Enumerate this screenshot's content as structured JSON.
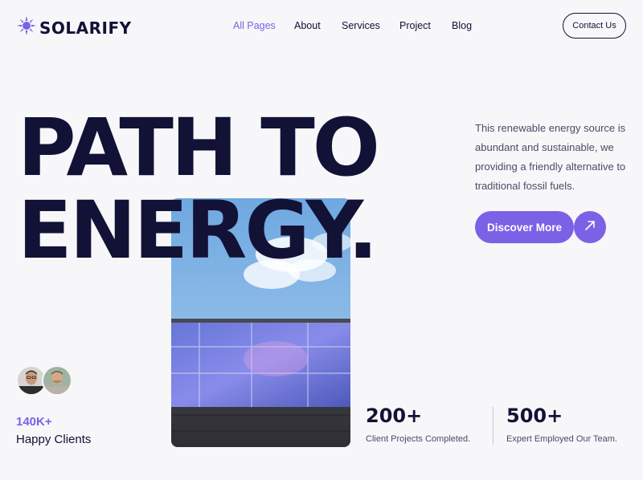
{
  "header": {
    "logo_text": "SOLARIFY",
    "nav": [
      "All Pages",
      "About",
      "Services",
      "Project",
      "Blog"
    ],
    "contact_label": "Contact Us"
  },
  "hero": {
    "title_line1": "PATH TO",
    "title_line2": "ENERGY.",
    "description": "This renewable energy source is abundant and sustainable, we providing a friendly alternative to traditional fossil fuels.",
    "discover_label": "Discover More"
  },
  "clients": {
    "count": "140K+",
    "label": "Happy Clients"
  },
  "stats": [
    {
      "value": "200+",
      "label": "Client Projects Completed."
    },
    {
      "value": "500+",
      "label": "Expert Employed Our Team."
    }
  ],
  "colors": {
    "accent": "#7b61e6",
    "dark": "#121236",
    "background": "#f7f6f9"
  },
  "icons": {
    "logo": "sun-icon",
    "arrow": "arrow-up-right-icon"
  }
}
